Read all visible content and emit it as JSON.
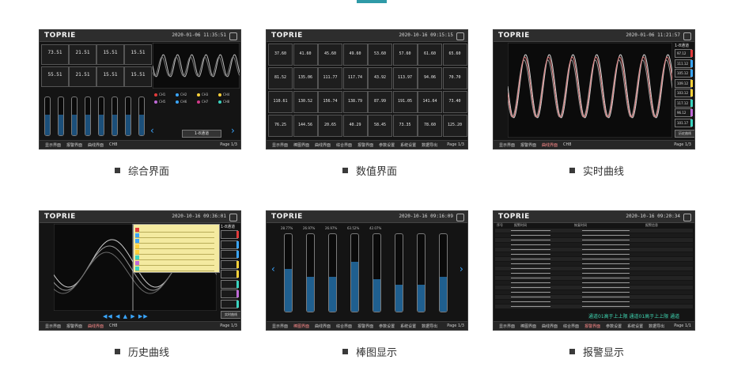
{
  "brand": "TOPRIE",
  "accent_color": "#2f9aa7",
  "screens": [
    {
      "caption": "综合界面",
      "datetime": "2020-01-06  11:35:51",
      "values": [
        "73.51",
        "21.51",
        "15.51",
        "15.51",
        "55.51",
        "21.51",
        "15.51",
        "15.51"
      ],
      "legend": [
        "CH1",
        "CH2",
        "CH3",
        "CH4",
        "CH5",
        "CH6",
        "CH7",
        "CH8"
      ],
      "channel_selector": "1-8通道",
      "footer": [
        "显示界面",
        "报警界面",
        "曲线界面",
        "CH8",
        "Page 1/3"
      ]
    },
    {
      "caption": "数值界面",
      "datetime": "2020-10-16  09:15:15",
      "values": [
        "37.60",
        "41.60",
        "45.60",
        "49.60",
        "53.60",
        "57.60",
        "61.60",
        "65.60",
        "81.52",
        "135.06",
        "111.77",
        "117.74",
        "43.92",
        "113.97",
        "94.06",
        "70.70",
        "110.61",
        "130.52",
        "156.74",
        "138.79",
        "87.99",
        "191.05",
        "141.64",
        "73.40",
        "76.25",
        "144.56",
        "20.65",
        "40.29",
        "58.45",
        "73.35",
        "78.60",
        "125.20"
      ],
      "footer": [
        "显示界面",
        "棒图界面",
        "曲线界面",
        "综合界面",
        "报警界面",
        "参数设置",
        "系统设置",
        "数据导出",
        "Page 1/3"
      ]
    },
    {
      "caption": "实时曲线",
      "datetime": "2020-01-06  11:21:57",
      "panel_title": "1-8通道",
      "channels": [
        "97.12",
        "111.12",
        "105.12",
        "109.12",
        "103.12",
        "117.12",
        "96.12",
        "101.17"
      ],
      "button": "历史曲线",
      "footer": [
        "显示界面",
        "报警界面",
        "曲线界面",
        "CH8",
        "Page 1/3"
      ]
    },
    {
      "caption": "历史曲线",
      "datetime": "2020-10-16  09:36:01",
      "panel_title": "1-8通道",
      "button": "实时曲线",
      "footer": [
        "显示界面",
        "报警界面",
        "曲线界面",
        "CH8",
        "Page 1/3"
      ]
    },
    {
      "caption": "棒图显示",
      "datetime": "2020-10-16  09:16:09",
      "percents": [
        "28.77%",
        "26.97%",
        "26.97%",
        "63.52%",
        "42.07%",
        "",
        "",
        ""
      ],
      "footer": [
        "显示界面",
        "棒图界面",
        "曲线界面",
        "综合界面",
        "报警界面",
        "参数设置",
        "系统设置",
        "数据导出",
        "Page 1/3"
      ]
    },
    {
      "caption": "报警显示",
      "datetime": "2020-10-16  09:20:34",
      "headers": [
        "序号",
        "报警时间",
        "恢复时间",
        "报警信息"
      ],
      "ticker": "通道01高于上上限   通道01高于上上限   通道",
      "footer": [
        "显示界面",
        "棒图界面",
        "曲线界面",
        "综合界面",
        "报警界面",
        "参数设置",
        "系统设置",
        "数据导出",
        "Page 1/1"
      ]
    }
  ],
  "chart_data": [
    {
      "type": "bar",
      "values": [
        0.55,
        0.55,
        0.55,
        0.55,
        0.55,
        0.55,
        0.55,
        0.55
      ]
    },
    {
      "type": "bar",
      "values": [
        0.55,
        0.45,
        0.45,
        0.64,
        0.42,
        0.35,
        0.35,
        0.45
      ]
    }
  ]
}
